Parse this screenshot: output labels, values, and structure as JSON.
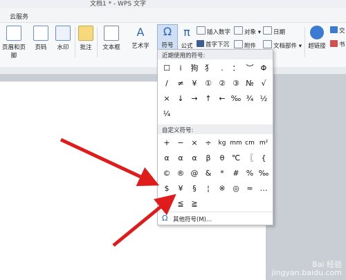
{
  "window": {
    "title": "文档1 * - WPS 文字"
  },
  "menu": {
    "cloud_label": "云服务"
  },
  "ribbon": {
    "header_footer": "页眉和页脚",
    "page_number": "页码",
    "watermark": "水印",
    "comment": "批注",
    "textbox": "文本框",
    "wordart": "艺术字",
    "symbol": "符号",
    "formula": "公式",
    "insert_number": "插入数字",
    "object": "对象",
    "date": "日期",
    "drop_cap": "首字下沉",
    "attachment": "附件",
    "doc_parts": "文档部件",
    "hyperlink": "超链接",
    "cross_ref_1": "交",
    "bookmark": "书"
  },
  "symbol_popup": {
    "recent_header": "近期使用的符号:",
    "recent_symbols": [
      "☐",
      "ⅰ",
      "狗",
      "犭",
      ".",
      "：",
      "︶",
      "Φ",
      "/",
      "≠",
      "¥",
      "①",
      "②",
      "③",
      "№",
      "√",
      "×",
      "↓",
      "→",
      "↑",
      "←",
      "‰",
      "¾",
      "½",
      "¼"
    ],
    "custom_header": "自定义符号:",
    "custom_symbols": [
      "+",
      "−",
      "×",
      "÷",
      "kg",
      "mm",
      "cm",
      "m²",
      "α",
      "α",
      "α",
      "β",
      "θ",
      "℃",
      "〖",
      "{",
      "©",
      "®",
      "@",
      "&",
      "*",
      "#",
      "%",
      "‰",
      "$",
      "¥",
      "§",
      "¦",
      "※",
      "◎",
      "≈",
      "…",
      "≥",
      "≦",
      "≧"
    ],
    "more_label": "其他符号(M)...",
    "more_icon": "Ω"
  },
  "watermark_text": {
    "line1": "Bai 经验",
    "line2": "jingyan.baidu.com"
  },
  "colors": {
    "arrow": "#e01b1b",
    "accent": "#2a64b8"
  }
}
